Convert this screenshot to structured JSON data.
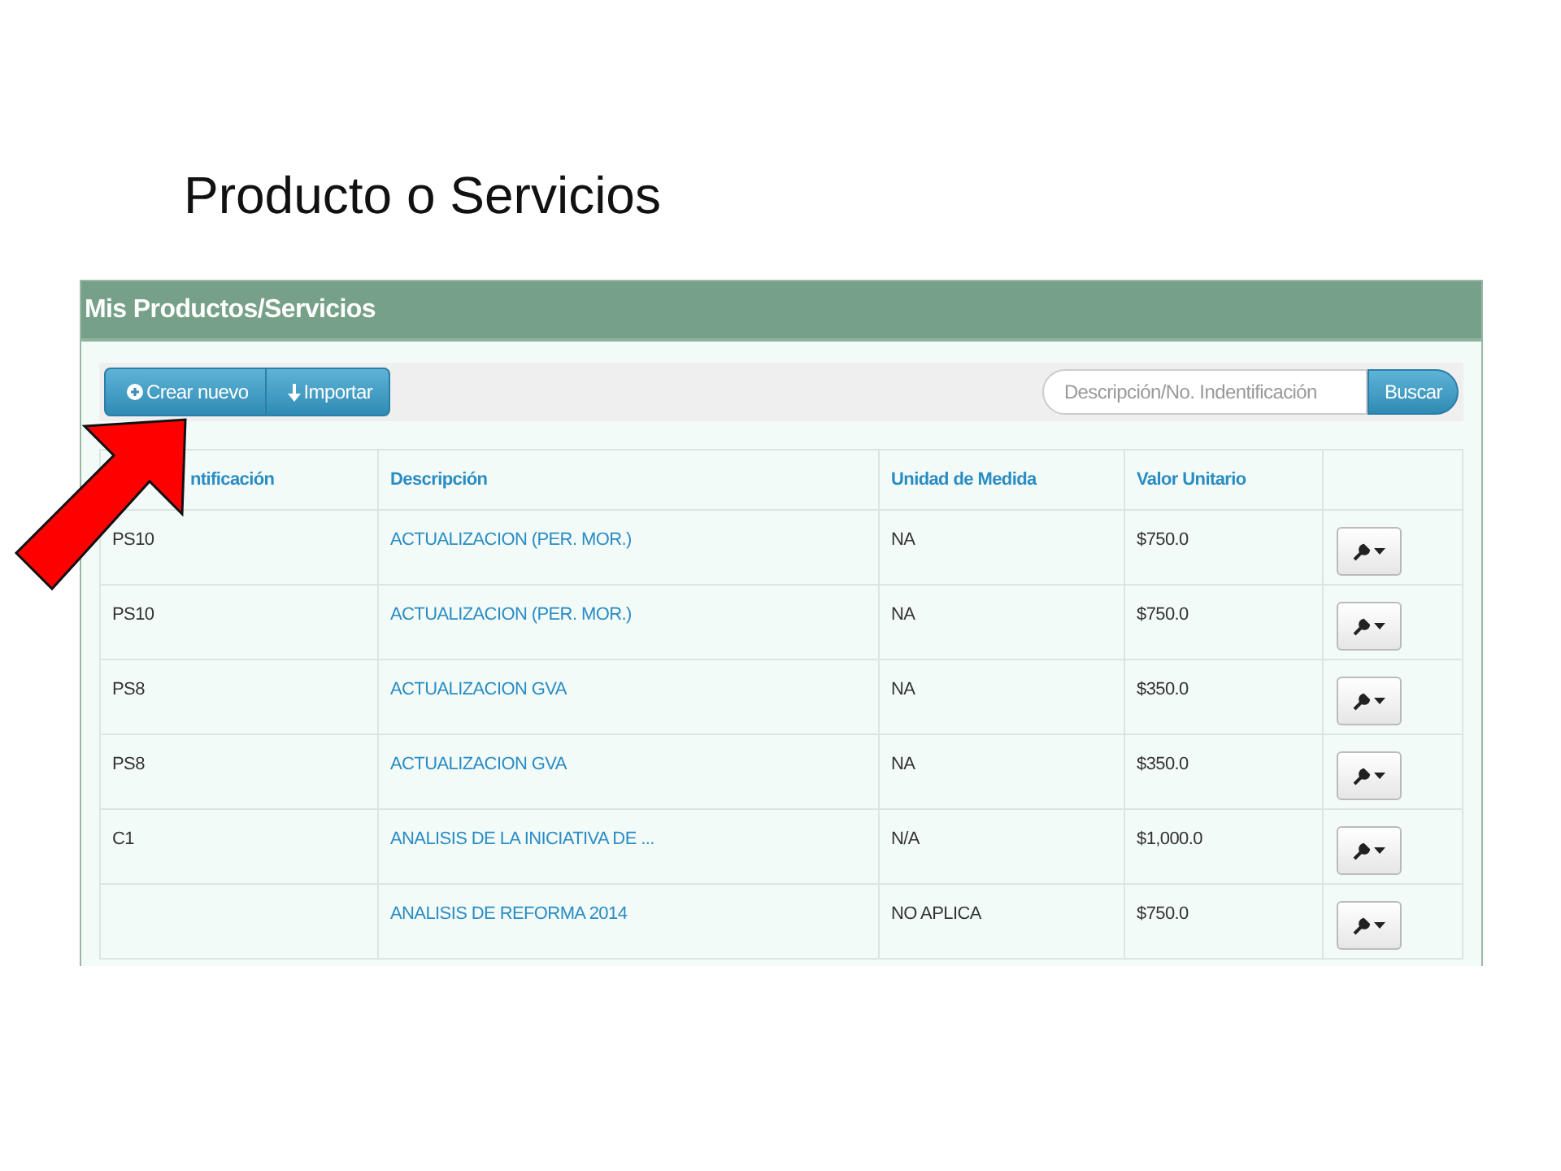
{
  "slide_title": "Producto o Servicios",
  "panel": {
    "title": "Mis Productos/Servicios",
    "toolbar": {
      "buttons": [
        {
          "label": "Crear nuevo",
          "kind": "create"
        },
        {
          "label": "Importar",
          "kind": "import"
        }
      ],
      "search": {
        "placeholder": "Descripción/No. Indentificación",
        "button": "Buscar"
      }
    },
    "table": {
      "columns": [
        "ntificación",
        "Descripción",
        "Unidad de Medida",
        "Valor Unitario"
      ],
      "rows": [
        {
          "id": "PS10",
          "description": "ACTUALIZACION (PER. MOR.)",
          "unit": "NA",
          "price": "$750.0"
        },
        {
          "id": "PS10",
          "description": "ACTUALIZACION (PER. MOR.)",
          "unit": "NA",
          "price": "$750.0"
        },
        {
          "id": "PS8",
          "description": "ACTUALIZACION GVA",
          "unit": "NA",
          "price": "$350.0"
        },
        {
          "id": "PS8",
          "description": "ACTUALIZACION GVA",
          "unit": "NA",
          "price": "$350.0"
        },
        {
          "id": "C1",
          "description": "ANALISIS DE LA INICIATIVA DE ...",
          "unit": "N/A",
          "price": "$1,000.0"
        },
        {
          "description": "ANALISIS DE REFORMA 2014",
          "unit": "NO APLICA",
          "price": "$750.0"
        }
      ]
    }
  }
}
